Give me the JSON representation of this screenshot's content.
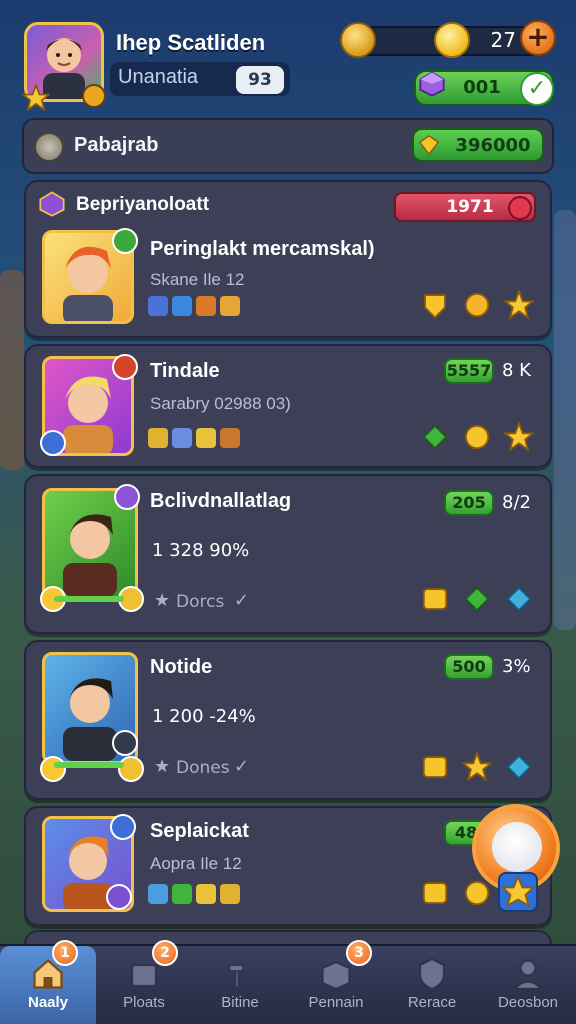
{
  "player": {
    "name": "Ihep Scatliden",
    "subtitle": "Unanatia",
    "level": "93"
  },
  "currency": {
    "coins": "27",
    "gems": "001"
  },
  "header": {
    "title": "Pabajrab",
    "value": "396000"
  },
  "cards": [
    {
      "section_title": "Bepriyanoloatt",
      "badge_value": "1971",
      "title": "Peringlakt mercamskal)",
      "subtitle": "Skane Ile 12"
    },
    {
      "title": "Tindale",
      "subtitle": "Sarabry 02988 03)",
      "pill": "5557",
      "rank": "8 K"
    },
    {
      "title": "Bclivdnallatlag",
      "stat": "1 328 90%",
      "done": "Dorcs",
      "pill": "205",
      "rank": "8/2"
    },
    {
      "title": "Notide",
      "stat": "1 200 -24%",
      "done": "Dones",
      "pill": "500",
      "rank": "3%"
    },
    {
      "title": "Seplaickat",
      "subtitle": "Aopra Ile 12",
      "pill": "48"
    }
  ],
  "nav": [
    {
      "label": "Naaly",
      "badge": "1",
      "icon": "home-icon",
      "active": true
    },
    {
      "label": "Ploats",
      "badge": "2",
      "icon": "crate-icon"
    },
    {
      "label": "Bitine",
      "icon": "hammer-icon"
    },
    {
      "label": "Pennain",
      "badge": "3",
      "icon": "box-icon"
    },
    {
      "label": "Rerace",
      "icon": "shield-icon"
    },
    {
      "label": "Deosbon",
      "icon": "profile-icon"
    }
  ],
  "colors": {
    "accent_green": "#34a131",
    "accent_orange": "#f07a1c",
    "gold": "#f1c24a",
    "card_bg": "#3c3f55",
    "red_pill": "#d63a52"
  }
}
